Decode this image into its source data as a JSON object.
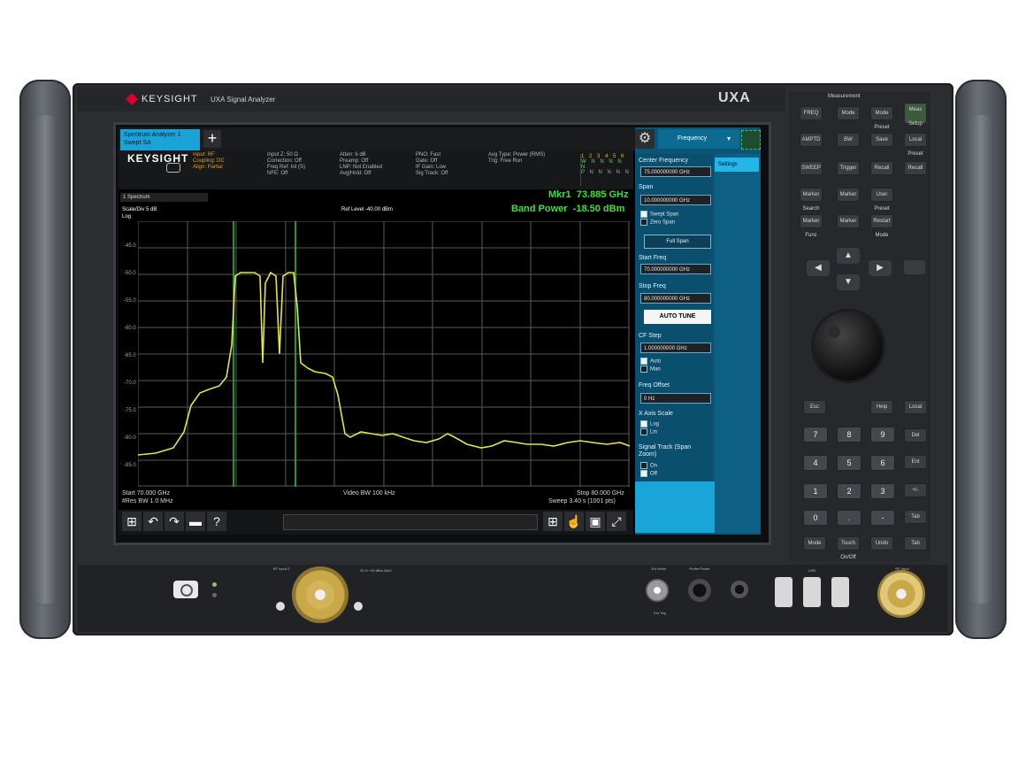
{
  "instrument": {
    "brand": "KEYSIGHT",
    "model_line": "UXA Signal Analyzer",
    "model_badge": "UXA",
    "measurement_label": "Measurement"
  },
  "screen": {
    "tab_label": "Spectrum Analyzer 1 Swept SA",
    "logo_text": "KEYSIGHT",
    "settings_header": "Frequency",
    "status_blocks": [
      "Input: RF\nCoupling: DC\nAlign: Partial",
      "Input Z: 50 Ω\nCorrection: Off\nFreq Ref: Int (S)\nNFE: Off",
      "Atten: 6 dB\nPreamp: Off\nLNP: Not Enabled\nAvg|Hold: Off",
      "PNO: Fast\nGate: Off\nIF Gain: Low\nSig Track: Off",
      "Avg Type: Power (RMS)\nTrig: Free Run"
    ],
    "trace_tab": "1 Spectrum",
    "scale_div": "Scale/Div 5 dB",
    "scale_type": "Log",
    "ref_level": "Ref Level -40.00 dBm",
    "marker_readout": "Mkr1  73.885 GHz",
    "band_power": "Band Power  -18.50 dBm",
    "y_ticks": [
      "-45.0",
      "-50.0",
      "-55.0",
      "-60.0",
      "-65.0",
      "-70.0",
      "-75.0",
      "-80.0",
      "-85.0"
    ],
    "start_freq": "Start 70.000 GHz",
    "res_bw": "#Res BW 1.0 MHz",
    "video_bw": "Video BW 100 kHz",
    "stop_freq": "Stop 80.000 GHz",
    "sweep": "Sweep 3.40 s (1001 pts)",
    "side_tab": "Settings",
    "menu": {
      "center_freq_label": "Center Frequency",
      "center_freq_value": "75.000000000 GHz",
      "span_label": "Span",
      "span_value": "10.000000000 GHz",
      "swept_span": "Swept Span",
      "zero_span": "Zero Span",
      "full_span": "Full Span",
      "start_freq_label": "Start Freq",
      "start_freq_value": "70.000000000 GHz",
      "stop_freq_label": "Stop Freq",
      "stop_freq_value": "80.000000000 GHz",
      "auto_tune": "AUTO TUNE",
      "cf_step_label": "CF Step",
      "cf_step_value": "1.000000000 GHz",
      "auto": "Auto",
      "man": "Man",
      "freq_offset_label": "Freq Offset",
      "freq_offset_value": "0 Hz",
      "xaxis_label": "X Axis Scale",
      "log": "Log",
      "lin": "Lin",
      "sig_track_label": "Signal Track (Span Zoom)",
      "on": "On",
      "off": "Off"
    }
  },
  "keypad": {
    "row1": [
      "FREQ",
      "Mode",
      "Mode Preset",
      "Meas Setup"
    ],
    "row2": [
      "AMPTD",
      "BW",
      "Save",
      "Local Preset"
    ],
    "row3": [
      "SWEEP",
      "Trigger",
      "Recall",
      "Recall"
    ],
    "row4": [
      "Marker Search",
      "Marker",
      "User Preset",
      ""
    ],
    "row5": [
      "Marker Func",
      "Marker",
      "Restart Mode",
      ""
    ],
    "numbers": [
      "7",
      "8",
      "9",
      "4",
      "5",
      "6",
      "1",
      "2",
      "3",
      "0",
      ".",
      "-"
    ],
    "right_col": [
      "Help",
      "Local",
      "Del",
      "Ent",
      "+/-",
      "Tab",
      "Esc"
    ],
    "bottom_row": [
      "Mode",
      "Touch On/Off",
      "Undo",
      "Tab"
    ],
    "enter": "Enter"
  },
  "front_panel": {
    "rf_input_2": "RF Input 2",
    "rf_input": "RF Input",
    "ext_mixer": "Ext Mixer",
    "probe_power": "Probe Power",
    "usb": "USB",
    "ext_trig": "Ext Trig",
    "max_power": "50 Ω +30 dBm MAX"
  }
}
